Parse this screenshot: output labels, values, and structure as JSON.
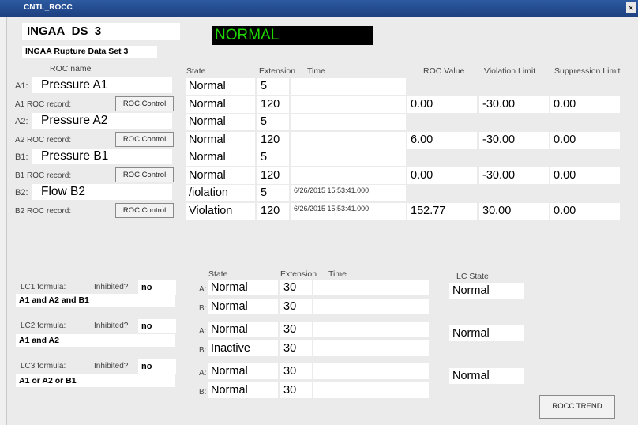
{
  "window": {
    "title": "CNTL_ROCC",
    "close_glyph": "×"
  },
  "header": {
    "dataset_id": "INGAA_DS_3",
    "status": "NORMAL",
    "dataset_name": "INGAA Rupture Data Set 3"
  },
  "roc_table": {
    "headers": {
      "roc_name": "ROC name",
      "state": "State",
      "extension": "Extension",
      "time": "Time",
      "roc_value": "ROC Value",
      "violation_limit": "Violation Limit",
      "suppression_limit": "Suppression Limit"
    },
    "rows": [
      {
        "prefix": "A1:",
        "name": "Pressure A1",
        "state": "Normal",
        "extension": "5",
        "time": "",
        "record_label": "A1 ROC record:",
        "button": "ROC Control",
        "rec_state": "Normal",
        "rec_extension": "120",
        "rec_time": "",
        "roc_value": "0.00",
        "violation_limit": "-30.00",
        "suppression_limit": "0.00"
      },
      {
        "prefix": "A2:",
        "name": "Pressure A2",
        "state": "Normal",
        "extension": "5",
        "time": "",
        "record_label": "A2 ROC record:",
        "button": "ROC Control",
        "rec_state": "Normal",
        "rec_extension": "120",
        "rec_time": "",
        "roc_value": "6.00",
        "violation_limit": "-30.00",
        "suppression_limit": "0.00"
      },
      {
        "prefix": "B1:",
        "name": "Pressure B1",
        "state": "Normal",
        "extension": "5",
        "time": "",
        "record_label": "B1 ROC record:",
        "button": "ROC Control",
        "rec_state": "Normal",
        "rec_extension": "120",
        "rec_time": "",
        "roc_value": "0.00",
        "violation_limit": "-30.00",
        "suppression_limit": "0.00"
      },
      {
        "prefix": "B2:",
        "name": "Flow B2",
        "state": "/iolation",
        "extension": "5",
        "time": "6/26/2015 15:53:41.000",
        "record_label": "B2 ROC record:",
        "button": "ROC Control",
        "rec_state": "Violation",
        "rec_extension": "120",
        "rec_time": "6/26/2015 15:53:41.000",
        "roc_value": "152.77",
        "violation_limit": "30.00",
        "suppression_limit": "0.00"
      }
    ]
  },
  "lc_section": {
    "headers": {
      "state": "State",
      "extension": "Extension",
      "time": "Time",
      "lc_state": "LC State"
    },
    "inhibited_label": "Inhibited?",
    "formulas": [
      {
        "label": "LC1 formula:",
        "inhibited": "no",
        "expression": "A1 and A2 and B1",
        "a_label": "A:",
        "a_state": "Normal",
        "a_extension": "30",
        "a_time": "",
        "b_label": "B:",
        "b_state": "Normal",
        "b_extension": "30",
        "b_time": "",
        "lc_state": "Normal"
      },
      {
        "label": "LC2 formula:",
        "inhibited": "no",
        "expression": "A1 and A2",
        "a_label": "A:",
        "a_state": "Normal",
        "a_extension": "30",
        "a_time": "",
        "b_label": "B:",
        "b_state": "Inactive",
        "b_extension": "30",
        "b_time": "",
        "lc_state": "Normal"
      },
      {
        "label": "LC3 formula:",
        "inhibited": "no",
        "expression": "A1 or A2 or B1",
        "a_label": "A:",
        "a_state": "Normal",
        "a_extension": "30",
        "a_time": "",
        "b_label": "B:",
        "b_state": "Normal",
        "b_extension": "30",
        "b_time": "",
        "lc_state": "Normal"
      }
    ]
  },
  "trend_button": "ROCC TREND"
}
